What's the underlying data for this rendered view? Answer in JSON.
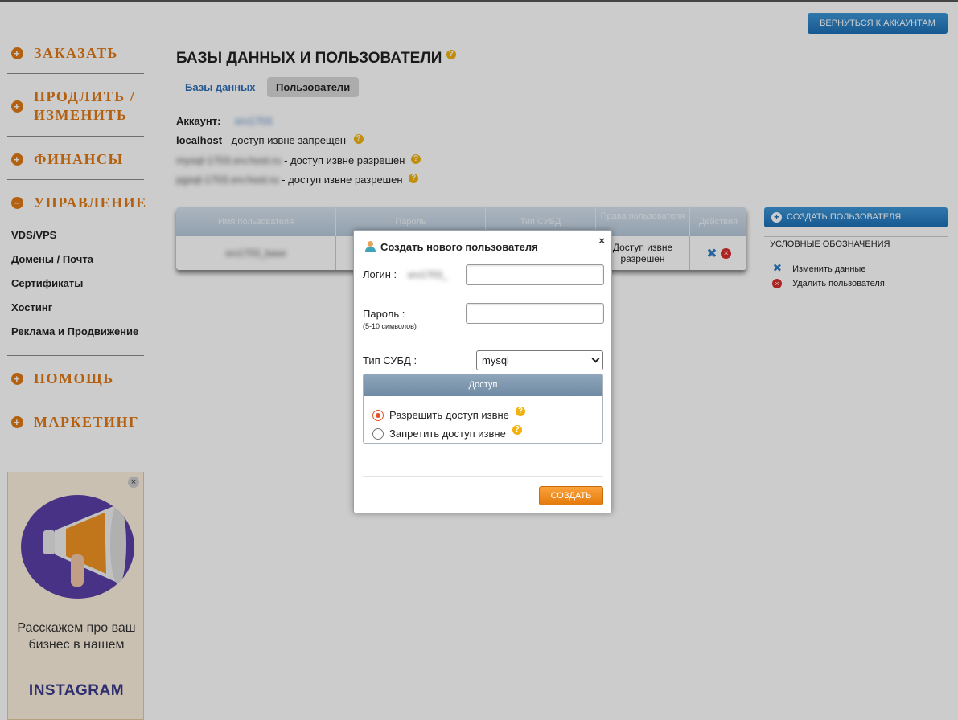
{
  "header": {
    "back_button": "ВЕРНУТЬСЯ К АККАУНТАМ"
  },
  "sidebar": {
    "menu": [
      {
        "label": "ЗАКАЗАТЬ",
        "icon": "plus-circle-icon"
      },
      {
        "label": "ПРОДЛИТЬ / ИЗМЕНИТЬ",
        "icon": "plus-circle-icon"
      },
      {
        "label": "ФИНАНСЫ",
        "icon": "plus-circle-icon"
      },
      {
        "label": "УПРАВЛЕНИЕ",
        "icon": "minus-circle-icon"
      },
      {
        "label": "ПОМОЩЬ",
        "icon": "plus-circle-icon"
      },
      {
        "label": "МАРКЕТИНГ",
        "icon": "plus-circle-icon"
      }
    ],
    "submenu": [
      "VDS/VPS",
      "Домены / Почта",
      "Сертификаты",
      "Хостинг",
      "Реклама и Продвижение"
    ],
    "ad": {
      "text": "Расскажем про ваш бизнес в нашем",
      "brand": "INSTAGRAM"
    }
  },
  "main": {
    "title": "БАЗЫ ДАННЫХ И ПОЛЬЗОВАТЕЛИ",
    "tabs": [
      "Базы данных",
      "Пользователи"
    ],
    "account_label": "Аккаунт:",
    "account_value": "srv1703",
    "hosts": [
      {
        "host": "localhost",
        "status": " - доступ извне запрещен"
      },
      {
        "host": "mysql-1703.srv.host.ru",
        "status": " - доступ извне разрешен"
      },
      {
        "host": "pgsql-1703.srv.host.ru",
        "status": " - доступ извне разрешен"
      }
    ],
    "table": {
      "headers": [
        "Имя пользователя",
        "Пароль",
        "Тип СУБД",
        "Права пользователя",
        "Действия"
      ],
      "rows": [
        {
          "username": "srv1703_base",
          "password": "",
          "db_type": "",
          "rights": "Доступ извне разрешен"
        }
      ]
    },
    "create_user_button": "СОЗДАТЬ ПОЛЬЗОВАТЕЛЯ",
    "legend": {
      "title": "УСЛОВНЫЕ ОБОЗНАЧЕНИЯ",
      "items": [
        {
          "icon": "wrench-icon",
          "label": "Изменить данные"
        },
        {
          "icon": "delete-icon",
          "label": "Удалить пользователя"
        }
      ]
    }
  },
  "dialog": {
    "title": "Создать нового пользователя",
    "close": "×",
    "login_label": "Логин :",
    "login_prefix": "srv1703_",
    "login_value": "",
    "password_label": "Пароль :",
    "password_hint": "(5-10 символов)",
    "password_value": "",
    "db_type_label": "Тип СУБД :",
    "db_type_value": "mysql",
    "access_title": "Доступ",
    "access_options": [
      "Разрешить доступ извне",
      "Запретить доступ извне"
    ],
    "access_selected": 0,
    "submit": "СОЗДАТЬ"
  },
  "colors": {
    "accent_orange": "#e07a16",
    "button_blue": "#1c6fb5",
    "submit_orange": "#f08c1f"
  }
}
